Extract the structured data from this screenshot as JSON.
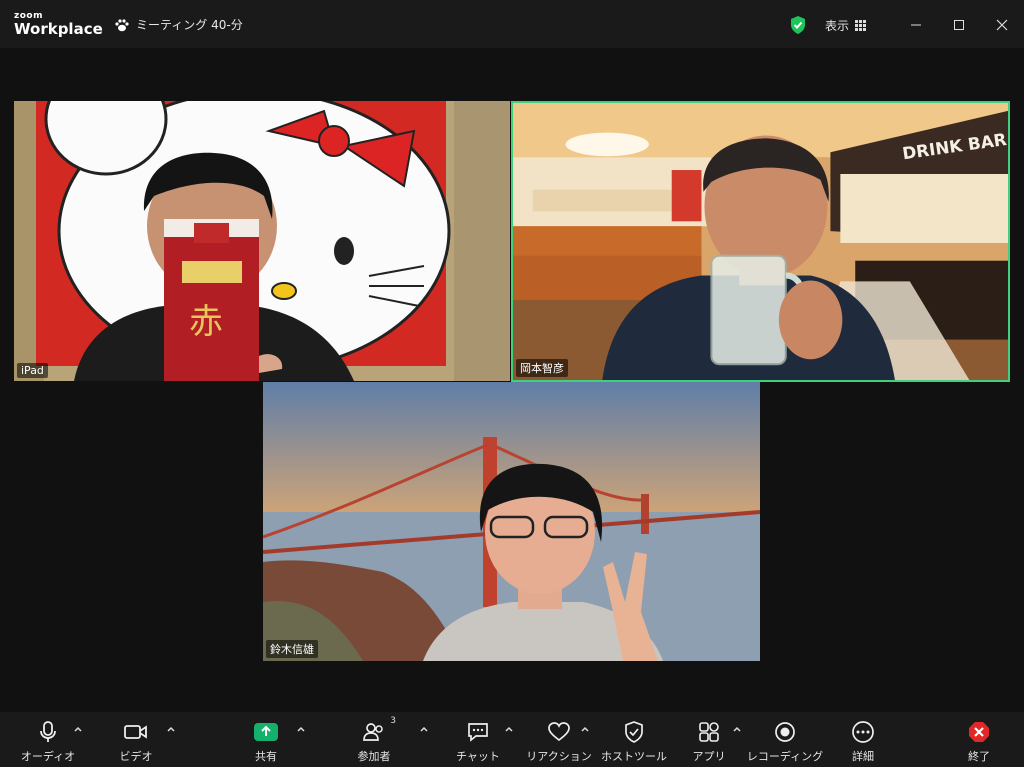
{
  "app": {
    "logo_small": "zoom",
    "logo_large": "Workplace"
  },
  "titlebar": {
    "meeting_label": "ミーティング 40-分",
    "view_label": "表示",
    "icons": [
      "paw-icon",
      "shield-check-icon",
      "grid-icon",
      "minimize-icon",
      "maximize-icon",
      "close-icon"
    ]
  },
  "participants": [
    {
      "name": "iPad"
    },
    {
      "name": "岡本智彦",
      "active_speaker": true
    },
    {
      "name": "鈴木信雄"
    }
  ],
  "scene_text": {
    "drink_bar": "DRINK BAR"
  },
  "toolbar": {
    "audio": "オーディオ",
    "video": "ビデオ",
    "share": "共有",
    "participants": "参加者",
    "participants_count": "3",
    "chat": "チャット",
    "reactions": "リアクション",
    "host_tools": "ホストツール",
    "apps": "アプリ",
    "recording": "レコーディング",
    "more": "詳細",
    "end": "終了"
  },
  "colors": {
    "accent_green": "#3fd07a",
    "share_green": "#14b06c",
    "end_red": "#e02828",
    "shield_green": "#1ec35a"
  }
}
